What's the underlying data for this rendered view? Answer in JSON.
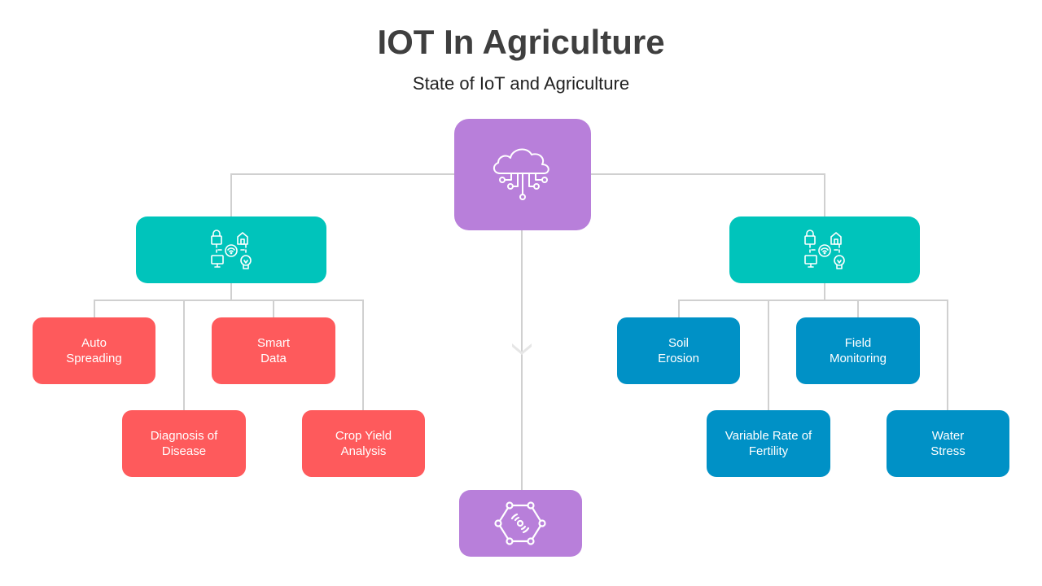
{
  "header": {
    "title": "IOT In Agriculture",
    "subtitle": "State of IoT and Agriculture"
  },
  "colors": {
    "root": "#b87fda",
    "branch": "#00c4bb",
    "left_leaves": "#fe5a5c",
    "right_leaves": "#0091c6",
    "connector": "#d0d0d0"
  },
  "root": {
    "icon": "cloud-network-icon"
  },
  "bottom_node": {
    "icon": "wireless-sensor-network-icon"
  },
  "left_branch": {
    "icon": "smart-devices-network-icon",
    "items": [
      {
        "label": "Auto\nSpreading"
      },
      {
        "label": "Diagnosis of\nDisease"
      },
      {
        "label": "Smart\nData"
      },
      {
        "label": "Crop Yield\nAnalysis"
      }
    ]
  },
  "right_branch": {
    "icon": "smart-devices-network-icon",
    "items": [
      {
        "label": "Soil\nErosion"
      },
      {
        "label": "Variable Rate of\nFertility"
      },
      {
        "label": "Field\nMonitoring"
      },
      {
        "label": "Water\nStress"
      }
    ]
  }
}
